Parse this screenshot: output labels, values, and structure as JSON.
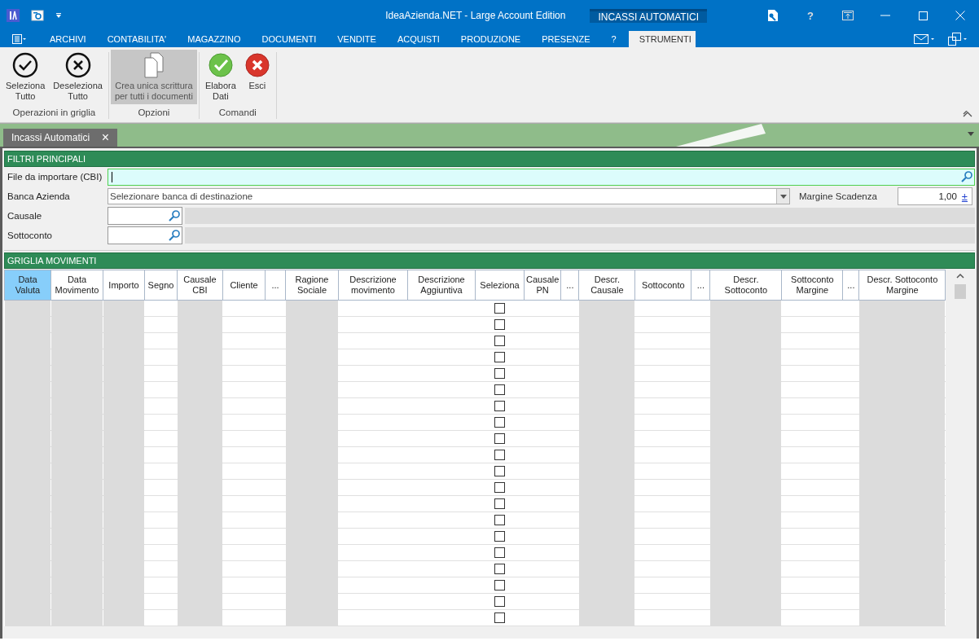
{
  "window": {
    "title": "IdeaAzienda.NET - Large Account Edition",
    "context_tab": "INCASSI AUTOMATICI",
    "help": "?"
  },
  "menu": {
    "items": [
      {
        "label": "ARCHIVI",
        "selected": false
      },
      {
        "label": "CONTABILITA'",
        "selected": false
      },
      {
        "label": "MAGAZZINO",
        "selected": false
      },
      {
        "label": "DOCUMENTI",
        "selected": false
      },
      {
        "label": "VENDITE",
        "selected": false
      },
      {
        "label": "ACQUISTI",
        "selected": false
      },
      {
        "label": "PRODUZIONE",
        "selected": false
      },
      {
        "label": "PRESENZE",
        "selected": false
      },
      {
        "label": "?",
        "selected": false
      },
      {
        "label": "STRUMENTI",
        "selected": true
      }
    ]
  },
  "ribbon": {
    "groups": [
      {
        "label": "Operazioni in griglia",
        "buttons": [
          {
            "kind": "check",
            "label": "Seleziona\nTutto",
            "pressed": false
          },
          {
            "kind": "cross",
            "label": "Deseleziona\nTutto",
            "pressed": false
          }
        ]
      },
      {
        "label": "Opzioni",
        "buttons": [
          {
            "kind": "documents",
            "label": "Crea unica scrittura\nper tutti i documenti",
            "pressed": true
          }
        ]
      },
      {
        "label": "Comandi",
        "buttons": [
          {
            "kind": "ok",
            "label": "Elabora\nDati",
            "pressed": false
          },
          {
            "kind": "cancel",
            "label": "Esci",
            "pressed": false
          }
        ]
      }
    ]
  },
  "doc_tabs": [
    {
      "label": "Incassi Automatici",
      "selected": true,
      "close": "×"
    }
  ],
  "filters": {
    "title": "FILTRI PRINCIPALI",
    "fields": [
      {
        "kind": "search",
        "label": "File da importare (CBI)",
        "focused": true
      },
      {
        "kind": "combo",
        "label": "Banca Azienda",
        "value": "Selezionare banca di destinazione"
      },
      {
        "kind": "lookup",
        "label": "Causale"
      },
      {
        "kind": "lookup",
        "label": "Sottoconto"
      }
    ],
    "margin": {
      "label": "Margine Scadenza",
      "value": "1,00",
      "spin": "±"
    }
  },
  "grid": {
    "title": "GRIGLIA MOVIMENTI",
    "columns": [
      {
        "label": "Data\nValuta",
        "readonly": true,
        "selected": true
      },
      {
        "label": "Data\nMovimento",
        "readonly": true,
        "selected": false
      },
      {
        "label": "Importo",
        "readonly": true,
        "selected": false
      },
      {
        "label": "Segno",
        "readonly": false,
        "selected": false
      },
      {
        "label": "Causale\nCBI",
        "readonly": true,
        "selected": false
      },
      {
        "label": "Cliente",
        "readonly": false,
        "selected": false
      },
      {
        "label": "...",
        "readonly": false,
        "selected": false
      },
      {
        "label": "Ragione\nSociale",
        "readonly": true,
        "selected": false
      },
      {
        "label": "Descrizione\nmovimento",
        "readonly": false,
        "selected": false
      },
      {
        "label": "Descrizione\nAggiuntiva",
        "readonly": false,
        "selected": false
      },
      {
        "label": "Seleziona",
        "readonly": false,
        "selected": false,
        "kind": "checkbox"
      },
      {
        "label": "Causale\nPN",
        "readonly": false,
        "selected": false
      },
      {
        "label": "...",
        "readonly": false,
        "selected": false
      },
      {
        "label": "Descr.\nCausale",
        "readonly": true,
        "selected": false
      },
      {
        "label": "Sottoconto",
        "readonly": false,
        "selected": false
      },
      {
        "label": "...",
        "readonly": false,
        "selected": false
      },
      {
        "label": "Descr.\nSottoconto",
        "readonly": true,
        "selected": false
      },
      {
        "label": "Sottoconto\nMargine",
        "readonly": false,
        "selected": false
      },
      {
        "label": "...",
        "readonly": false,
        "selected": false
      },
      {
        "label": "Descr. Sottoconto\nMargine",
        "readonly": true,
        "selected": false
      }
    ],
    "rows": [
      {
        "checked": false
      },
      {
        "checked": false
      },
      {
        "checked": false
      },
      {
        "checked": false
      },
      {
        "checked": false
      },
      {
        "checked": false
      },
      {
        "checked": false
      },
      {
        "checked": false
      },
      {
        "checked": false
      },
      {
        "checked": false
      },
      {
        "checked": false
      },
      {
        "checked": false
      },
      {
        "checked": false
      },
      {
        "checked": false
      },
      {
        "checked": false
      },
      {
        "checked": false
      },
      {
        "checked": false
      },
      {
        "checked": false
      },
      {
        "checked": false
      },
      {
        "checked": false
      }
    ]
  }
}
